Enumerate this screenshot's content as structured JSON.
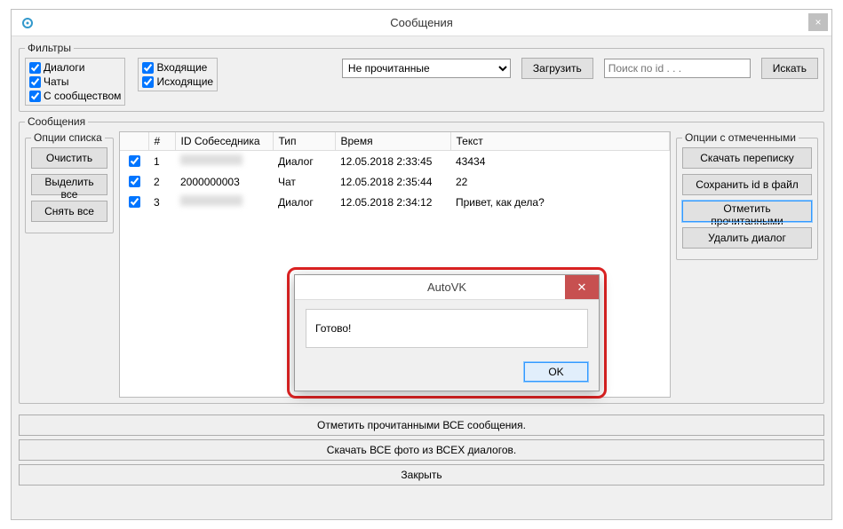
{
  "window": {
    "title": "Сообщения",
    "close": "×"
  },
  "filters": {
    "legend": "Фильтры",
    "group1": {
      "dialogs": "Диалоги",
      "chats": "Чаты",
      "community": "С сообществом"
    },
    "group2": {
      "incoming": "Входящие",
      "outgoing": "Исходящие"
    },
    "readFilter": {
      "selected": "Не прочитанные"
    },
    "loadBtn": "Загрузить",
    "searchPlaceholder": "Поиск по id . . .",
    "searchBtn": "Искать"
  },
  "messages": {
    "legend": "Сообщения",
    "listOps": {
      "legend": "Опции списка",
      "clear": "Очистить",
      "selectAll": "Выделить все",
      "deselectAll": "Снять все"
    },
    "columns": {
      "num": "#",
      "id": "ID Собеседника",
      "type": "Тип",
      "time": "Время",
      "text": "Текст"
    },
    "rows": [
      {
        "n": "1",
        "id": "",
        "type": "Диалог",
        "time": "12.05.2018 2:33:45",
        "text": "43434"
      },
      {
        "n": "2",
        "id": "2000000003",
        "type": "Чат",
        "time": "12.05.2018 2:35:44",
        "text": "22"
      },
      {
        "n": "3",
        "id": "",
        "type": "Диалог",
        "time": "12.05.2018 2:34:12",
        "text": "Привет, как дела?"
      }
    ],
    "markedOps": {
      "legend": "Опции с отмеченными",
      "download": "Скачать переписку",
      "saveIds": "Сохранить id в файл",
      "markRead": "Отметить прочитанными",
      "deleteDialog": "Удалить диалог"
    }
  },
  "bottom": {
    "markAllRead": "Отметить прочитанными ВСЕ сообщения.",
    "downloadAllPhotos": "Скачать ВСЕ фото из ВСЕХ диалогов.",
    "close": "Закрыть"
  },
  "modal": {
    "title": "AutoVK",
    "body": "Готово!",
    "ok": "OK",
    "close": "✕"
  }
}
